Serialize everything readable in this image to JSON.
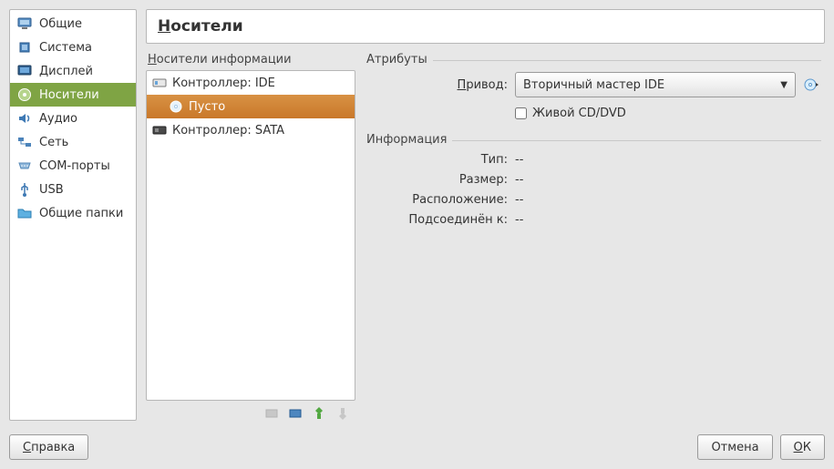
{
  "sidebar": {
    "items": [
      {
        "label": "Общие",
        "icon": "monitor",
        "color": "#3A7EC1"
      },
      {
        "label": "Система",
        "icon": "chip",
        "color": "#3A7EC1"
      },
      {
        "label": "Дисплей",
        "icon": "display",
        "color": "#3A7EC1"
      },
      {
        "label": "Носители",
        "icon": "disc",
        "color": "#4C7A2F",
        "selected": true
      },
      {
        "label": "Аудио",
        "icon": "speaker",
        "color": "#3A7EC1"
      },
      {
        "label": "Сеть",
        "icon": "network",
        "color": "#3A7EC1"
      },
      {
        "label": "COM-порты",
        "icon": "serial",
        "color": "#6AA0D8"
      },
      {
        "label": "USB",
        "icon": "usb",
        "color": "#3A7EC1"
      },
      {
        "label": "Общие папки",
        "icon": "folder",
        "color": "#4DA3D4"
      }
    ]
  },
  "header": {
    "title_plain": "Носители",
    "title_prefix": "Н",
    "title_rest": "осители"
  },
  "storage_panel": {
    "title_prefix": "Н",
    "title_rest": "осители информации",
    "tree": [
      {
        "label": "Контроллер: IDE",
        "icon": "ide",
        "level": 0
      },
      {
        "label": "Пусто",
        "icon": "cd",
        "level": 1,
        "selected": true
      },
      {
        "label": "Контроллер: SATA",
        "icon": "sata",
        "level": 0
      }
    ],
    "toolbar": [
      "add-controller-disabled",
      "add-controller",
      "add-attachment",
      "remove-attachment"
    ]
  },
  "attributes": {
    "group_title": "Атрибуты",
    "drive_label_prefix": "П",
    "drive_label_rest": "ривод:",
    "drive_value": "Вторичный мастер IDE",
    "live_cd_prefix": "Ж",
    "live_cd_rest": "ивой CD/DVD"
  },
  "info": {
    "group_title": "Информация",
    "rows": [
      {
        "label": "Тип:",
        "value": "--"
      },
      {
        "label": "Размер:",
        "value": "--"
      },
      {
        "label": "Расположение:",
        "value": "--"
      },
      {
        "label": "Подсоединён к:",
        "value": "--"
      }
    ]
  },
  "footer": {
    "help_prefix": "С",
    "help_rest": "правка",
    "cancel": "Отмена",
    "ok_prefix": "О",
    "ok_rest": "К"
  }
}
